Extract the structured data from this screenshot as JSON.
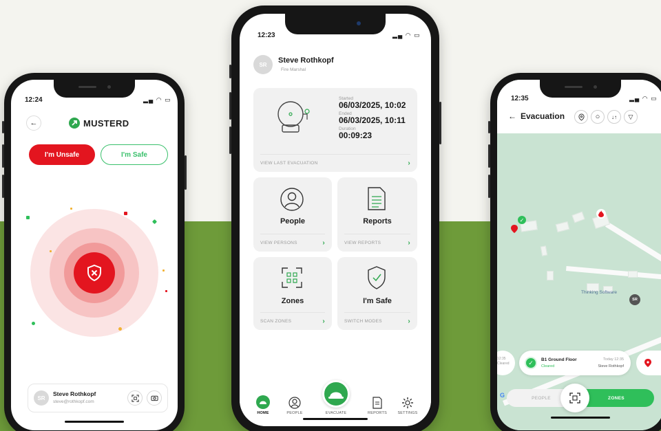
{
  "phone1": {
    "time": "12:24",
    "brand": "MUSTERD",
    "unsafe_label": "I'm Unsafe",
    "safe_label": "I'm Safe",
    "user": {
      "initials": "SR",
      "name": "Steve Rothkopf",
      "email": "steve@rothkopf.com"
    },
    "colors": {
      "danger": "#e3151f",
      "safe": "#39c06b"
    }
  },
  "phone2": {
    "time": "12:23",
    "user": {
      "initials": "SR",
      "name": "Steve Rothkopf",
      "role": "Fire Marshal"
    },
    "evacuation": {
      "started_label": "Started",
      "started": "06/03/2025, 10:02",
      "ended_label": "Ended",
      "ended": "06/03/2025, 10:11",
      "duration_label": "Duration",
      "duration": "00:09:23",
      "link": "VIEW LAST EVACUATION"
    },
    "tiles": [
      {
        "title": "People",
        "link": "VIEW PERSONS",
        "icon": "person-icon"
      },
      {
        "title": "Reports",
        "link": "VIEW REPORTS",
        "icon": "document-icon"
      },
      {
        "title": "Zones",
        "link": "SCAN ZONES",
        "icon": "qr-scan-icon"
      },
      {
        "title": "I'm Safe",
        "link": "SWITCH MODES",
        "icon": "shield-check-icon"
      }
    ],
    "tabs": [
      {
        "label": "HOME",
        "icon": "helmet-icon"
      },
      {
        "label": "PEOPLE",
        "icon": "person-icon"
      },
      {
        "label": "EVACUATE",
        "icon": "helmet-icon"
      },
      {
        "label": "REPORTS",
        "icon": "document-icon"
      },
      {
        "label": "SETTINGS",
        "icon": "gear-icon"
      }
    ],
    "colors": {
      "accent": "#2fa84f"
    }
  },
  "phone3": {
    "time": "12:35",
    "title": "Evacuation",
    "map_label": "Thinking Software",
    "map_avatar": "SR",
    "zone_card": {
      "name": "B1 Ground Floor",
      "status": "Cleared",
      "time": "Today 12:35",
      "by": "Steve Rothkopf"
    },
    "left_peek": {
      "time": "12:35",
      "status": "Cleared"
    },
    "toggle": {
      "people": "PEOPLE",
      "zones": "ZONES"
    },
    "google": "G",
    "colors": {
      "map": "#c9e3d2",
      "accent": "#2fbf5a"
    }
  }
}
